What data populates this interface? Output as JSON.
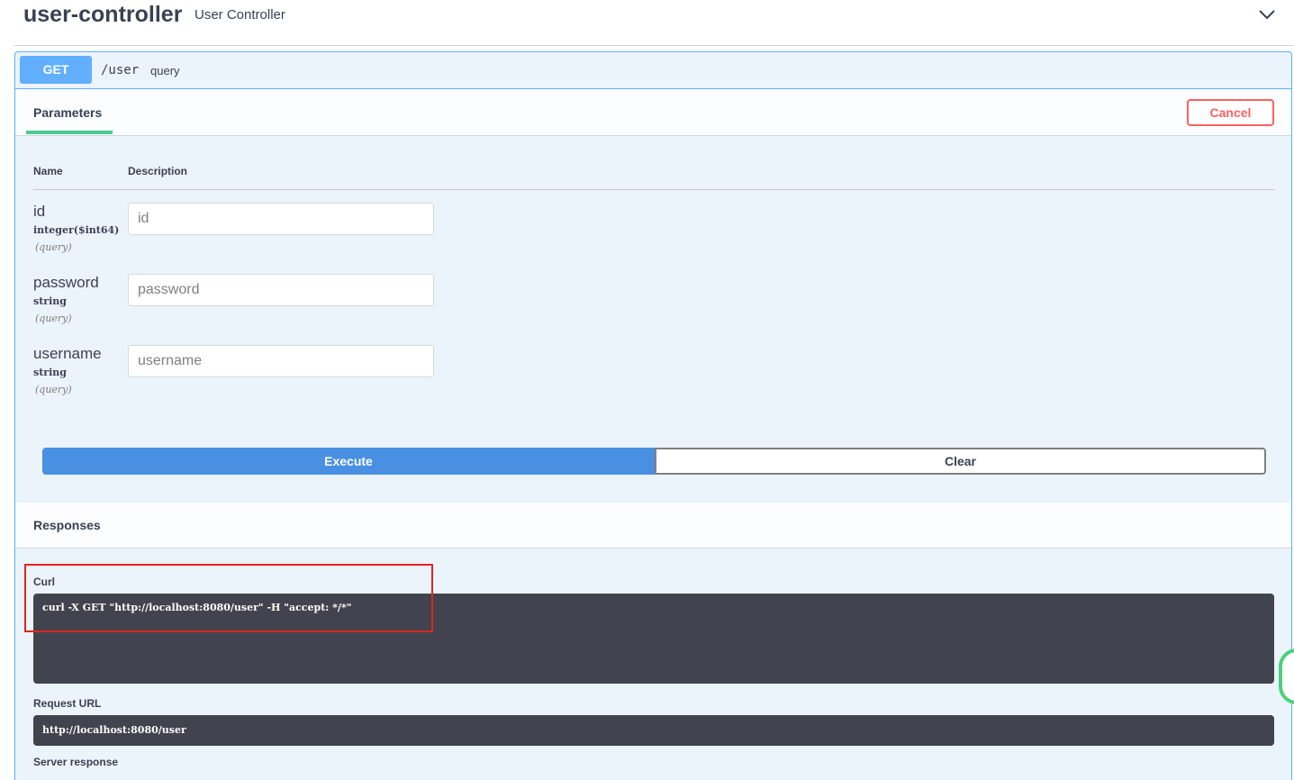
{
  "tag": {
    "name": "user-controller",
    "description": "User Controller",
    "chevron_icon": "chevron-down-icon"
  },
  "operation": {
    "method": "GET",
    "path": "/user",
    "summary": "query"
  },
  "parameters": {
    "tab_label": "Parameters",
    "cancel_label": "Cancel",
    "col_name": "Name",
    "col_description": "Description",
    "items": [
      {
        "name": "id",
        "type": "integer($int64)",
        "in": "(query)",
        "placeholder": "id"
      },
      {
        "name": "password",
        "type": "string",
        "in": "(query)",
        "placeholder": "password"
      },
      {
        "name": "username",
        "type": "string",
        "in": "(query)",
        "placeholder": "username"
      }
    ]
  },
  "actions": {
    "execute_label": "Execute",
    "clear_label": "Clear"
  },
  "responses": {
    "title": "Responses",
    "curl_label": "Curl",
    "curl_command": "curl -X GET \"http://localhost:8080/user\" -H \"accept: */*\"",
    "request_url_label": "Request URL",
    "request_url": "http://localhost:8080/user",
    "server_response_label": "Server response"
  },
  "colors": {
    "get_blue": "#61affe",
    "execute_blue": "#4990e2",
    "cancel_red": "#ff6060",
    "tab_green": "#49cc90",
    "code_bg": "#41444e",
    "highlight_red": "#e0251f"
  }
}
